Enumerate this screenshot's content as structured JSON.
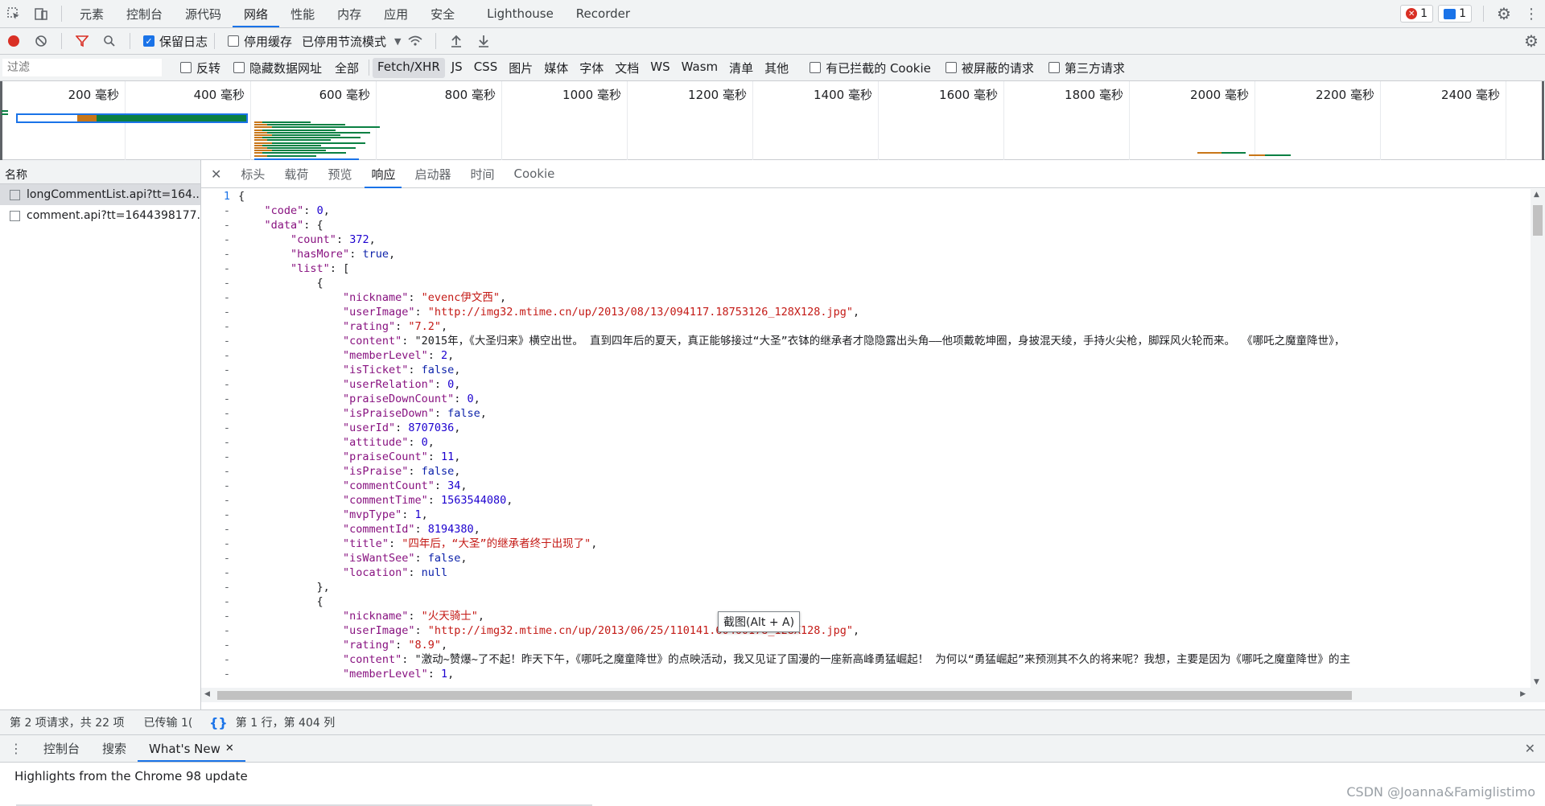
{
  "top_tabs": [
    "元素",
    "控制台",
    "源代码",
    "网络",
    "性能",
    "内存",
    "应用",
    "安全",
    "Lighthouse",
    "Recorder"
  ],
  "active_tab": "网络",
  "error_count": "1",
  "message_count": "1",
  "toolbar": {
    "preserve_log": "保留日志",
    "disable_cache": "停用缓存",
    "throttling": "已停用节流模式"
  },
  "filter": {
    "placeholder": "过滤",
    "invert": "反转",
    "hide_data_urls": "隐藏数据网址",
    "all": "全部",
    "types": [
      "Fetch/XHR",
      "JS",
      "CSS",
      "图片",
      "媒体",
      "字体",
      "文档",
      "WS",
      "Wasm",
      "清单",
      "其他"
    ],
    "active_type": "Fetch/XHR",
    "blocked_cookies": "有已拦截的 Cookie",
    "blocked_requests": "被屏蔽的请求",
    "third_party": "第三方请求"
  },
  "overview_ticks": [
    "200 毫秒",
    "400 毫秒",
    "600 毫秒",
    "800 毫秒",
    "1000 毫秒",
    "1200 毫秒",
    "1400 毫秒",
    "1600 毫秒",
    "1800 毫秒",
    "2000 毫秒",
    "2200 毫秒",
    "2400 毫秒"
  ],
  "requests": {
    "header": "名称",
    "items": [
      "longCommentList.api?tt=164...",
      "comment.api?tt=1644398177..."
    ]
  },
  "detail_tabs": [
    "标头",
    "载荷",
    "预览",
    "响应",
    "启动器",
    "时间",
    "Cookie"
  ],
  "active_detail_tab": "响应",
  "response_lines": [
    {
      "g": "1",
      "t": "{"
    },
    {
      "g": "-",
      "t": "    \"code\": 0,"
    },
    {
      "g": "-",
      "t": "    \"data\": {"
    },
    {
      "g": "-",
      "t": "        \"count\": 372,"
    },
    {
      "g": "-",
      "t": "        \"hasMore\": true,"
    },
    {
      "g": "-",
      "t": "        \"list\": ["
    },
    {
      "g": "-",
      "t": "            {"
    },
    {
      "g": "-",
      "t": "                \"nickname\": \"evenc伊文西\","
    },
    {
      "g": "-",
      "t": "                \"userImage\": \"http://img32.mtime.cn/up/2013/08/13/094117.18753126_128X128.jpg\","
    },
    {
      "g": "-",
      "t": "                \"rating\": \"7.2\","
    },
    {
      "g": "-",
      "t": "                \"content\": \"2015年，《大圣归来》横空出世。 直到四年后的夏天，真正能够接过“大圣”衣钵的继承者才隐隐露出头角——他项戴乾坤圈，身披混天绫，手持火尖枪，脚踩风火轮而来。 《哪吒之魔童降世》，"
    },
    {
      "g": "-",
      "t": "                \"memberLevel\": 2,"
    },
    {
      "g": "-",
      "t": "                \"isTicket\": false,"
    },
    {
      "g": "-",
      "t": "                \"userRelation\": 0,"
    },
    {
      "g": "-",
      "t": "                \"praiseDownCount\": 0,"
    },
    {
      "g": "-",
      "t": "                \"isPraiseDown\": false,"
    },
    {
      "g": "-",
      "t": "                \"userId\": 8707036,"
    },
    {
      "g": "-",
      "t": "                \"attitude\": 0,"
    },
    {
      "g": "-",
      "t": "                \"praiseCount\": 11,"
    },
    {
      "g": "-",
      "t": "                \"isPraise\": false,"
    },
    {
      "g": "-",
      "t": "                \"commentCount\": 34,"
    },
    {
      "g": "-",
      "t": "                \"commentTime\": 1563544080,"
    },
    {
      "g": "-",
      "t": "                \"mvpType\": 1,"
    },
    {
      "g": "-",
      "t": "                \"commentId\": 8194380,"
    },
    {
      "g": "-",
      "t": "                \"title\": \"四年后，“大圣”的继承者终于出现了\","
    },
    {
      "g": "-",
      "t": "                \"isWantSee\": false,"
    },
    {
      "g": "-",
      "t": "                \"location\": null"
    },
    {
      "g": "-",
      "t": "            },"
    },
    {
      "g": "-",
      "t": "            {"
    },
    {
      "g": "-",
      "t": "                \"nickname\": \"火天骑士\","
    },
    {
      "g": "-",
      "t": "                \"userImage\": \"http://img32.mtime.cn/up/2013/06/25/110141.60460178_128X128.jpg\","
    },
    {
      "g": "-",
      "t": "                \"rating\": \"8.9\","
    },
    {
      "g": "-",
      "t": "                \"content\": \"激动~赞爆~了不起！昨天下午，《哪吒之魔童降世》的点映活动，我又见证了国漫的一座新高峰勇猛崛起！ 为何以“勇猛崛起”来预测其不久的将来呢？我想，主要是因为《哪吒之魔童降世》的主"
    },
    {
      "g": "-",
      "t": "                \"memberLevel\": 1,"
    }
  ],
  "tooltip": "截图(Alt + A)",
  "left_status": "第 2 项请求，共 22 项",
  "left_status2": "已传输 1(",
  "cursor_pos": "第 1 行，第 404 列",
  "drawer": {
    "tabs": [
      "控制台",
      "搜索",
      "What's New"
    ],
    "active": "What's New",
    "body": "Highlights from the Chrome 98 update"
  },
  "watermark": "CSDN @Joanna&Famiglistimo",
  "colors": {
    "accent": "#1a73e8",
    "error": "#d93025",
    "string": "#c41a16",
    "number": "#1c00cf",
    "key": "#881280"
  }
}
